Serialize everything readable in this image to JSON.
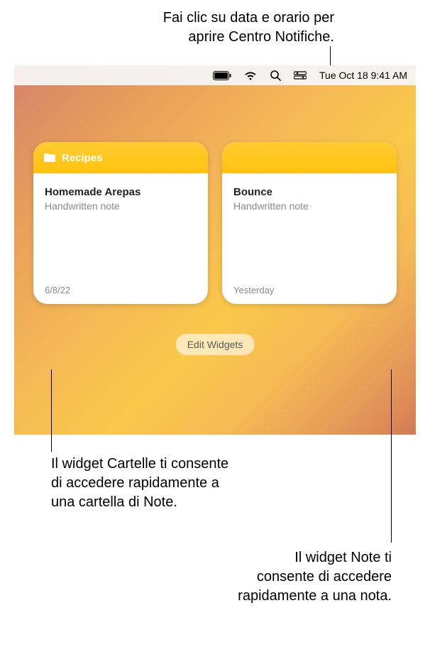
{
  "callouts": {
    "top_line1": "Fai clic su data e orario per",
    "top_line2": "aprire Centro Notifiche.",
    "mid_line1": "Il widget Cartelle ti consente",
    "mid_line2": "di accedere rapidamente a",
    "mid_line3": "una cartella di Note.",
    "bottom_line1": "Il widget Note ti",
    "bottom_line2": "consente di accedere",
    "bottom_line3": "rapidamente a una nota."
  },
  "menubar": {
    "datetime": "Tue Oct 18  9:41 AM"
  },
  "widgets": {
    "folder": {
      "title": "Recipes",
      "note_title": "Homemade Arepas",
      "note_sub": "Handwritten note",
      "date": "6/8/22"
    },
    "note": {
      "note_title": "Bounce",
      "note_sub": "Handwritten note",
      "date": "Yesterday"
    }
  },
  "edit_button": "Edit Widgets"
}
